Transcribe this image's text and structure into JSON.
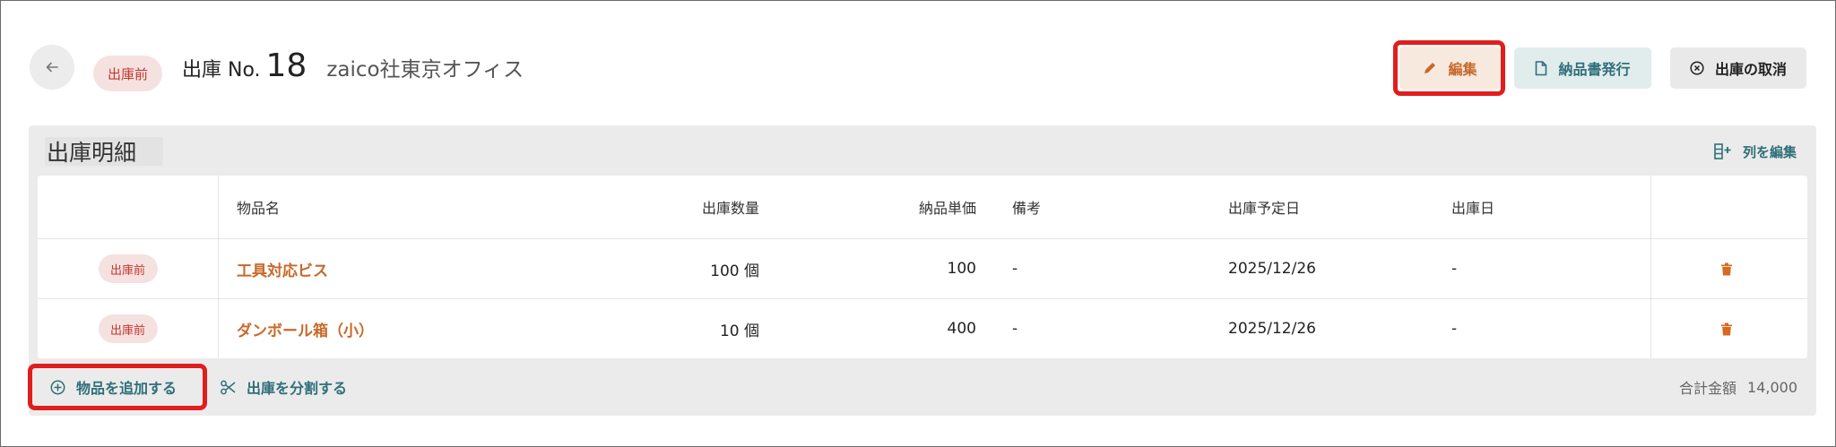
{
  "header": {
    "status": "出庫前",
    "title_prefix": "出庫 No.",
    "title_number": "18",
    "destination": "zaico社東京オフィス",
    "buttons": {
      "edit": "編集",
      "invoice": "納品書発行",
      "cancel": "出庫の取消"
    }
  },
  "panel": {
    "title": "出庫明細",
    "edit_columns": "列を編集",
    "columns": [
      "物品名",
      "出庫数量",
      "納品単価",
      "備考",
      "出庫予定日",
      "出庫日"
    ],
    "rows": [
      {
        "status": "出庫前",
        "name": "工具対応ビス",
        "qty": "100 個",
        "price": "100",
        "note": "-",
        "planned": "2025/12/26",
        "date": "-"
      },
      {
        "status": "出庫前",
        "name": "ダンボール箱（小）",
        "qty": "10 個",
        "price": "400",
        "note": "-",
        "planned": "2025/12/26",
        "date": "-"
      }
    ],
    "footer": {
      "add_item": "物品を追加する",
      "split": "出庫を分割する",
      "total_label": "合計金額",
      "total_value": "14,000"
    }
  },
  "colors": {
    "accent_orange": "#c7692a",
    "accent_teal": "#2f6f7a",
    "status_red": "#c0392b",
    "highlight_red": "#e11d1d"
  },
  "icons": {
    "back": "arrow-left-icon",
    "edit": "pencil-icon",
    "invoice": "document-icon",
    "cancel": "circle-x-icon",
    "edit_columns": "column-plus-icon",
    "delete": "trash-icon",
    "add": "circle-plus-icon",
    "split": "scissors-icon"
  }
}
